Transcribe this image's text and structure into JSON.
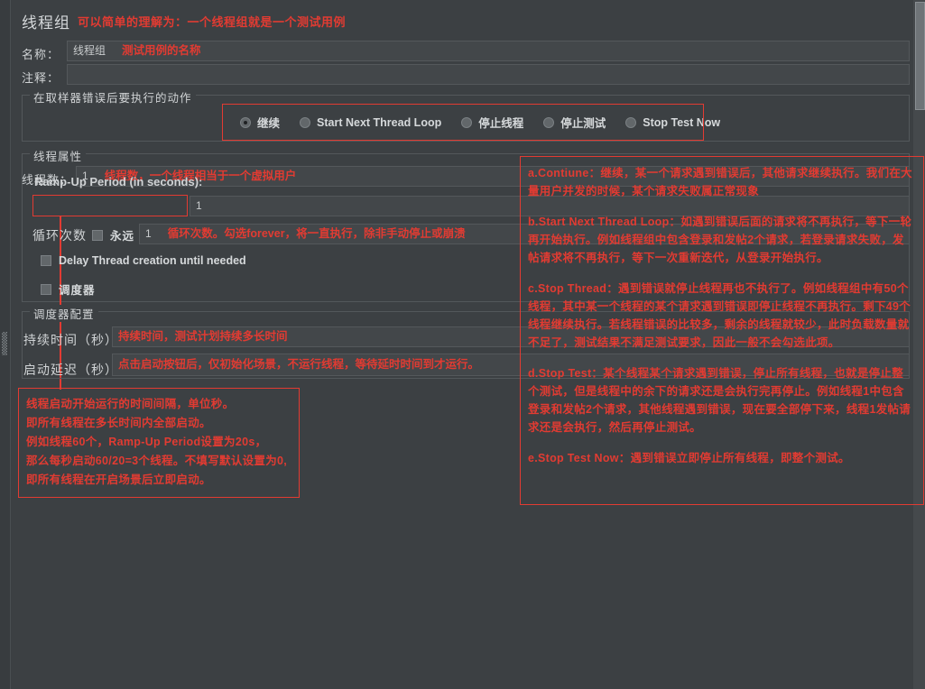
{
  "window": {
    "title": "线程组",
    "title_note": "可以简单的理解为：一个线程组就是一个测试用例"
  },
  "form": {
    "name_label": "名称：",
    "name_value": "线程组",
    "name_note": "测试用例的名称",
    "comment_label": "注释：",
    "comment_value": ""
  },
  "error_action": {
    "group_title": "在取样器错误后要执行的动作",
    "options": [
      {
        "label": "继续",
        "selected": true
      },
      {
        "label": "Start Next Thread Loop",
        "selected": false
      },
      {
        "label": "停止线程",
        "selected": false
      },
      {
        "label": "停止测试",
        "selected": false
      },
      {
        "label": "Stop Test Now",
        "selected": false
      }
    ]
  },
  "thread_props": {
    "group_title": "线程属性",
    "threads_label": "线程数：",
    "threads_value": "1",
    "threads_note": "线程数，一个线程相当于一个虚拟用户",
    "rampup_label": "Ramp-Up Period (in seconds):",
    "rampup_value": "1",
    "loop_label": "循环次数",
    "forever_label": "永远",
    "forever_checked": false,
    "loop_value": "1",
    "loop_note": "循环次数。勾选forever，将一直执行，除非手动停止或崩溃",
    "delay_thread_label": "Delay Thread creation until needed",
    "delay_thread_checked": false,
    "scheduler_checkbox_label": "调度器",
    "scheduler_checked": false
  },
  "scheduler": {
    "group_title": "调度器配置",
    "duration_label": "持续时间（秒）",
    "duration_value": "",
    "duration_note": "持续时间，测试计划持续多长时间",
    "delay_label": "启动延迟（秒）",
    "delay_value": "",
    "delay_note": "点击启动按钮后，仅初始化场景，不运行线程，等待延时时间到才运行。"
  },
  "rampup_note": {
    "lines": [
      "线程启动开始运行的时间间隔，单位秒。",
      "即所有线程在多长时间内全部启动。",
      "例如线程60个，Ramp-Up Period设置为20s，",
      "那么每秒启动60/20=3个线程。不填写默认设置为0,",
      "即所有线程在开启场景后立即启动。"
    ]
  },
  "action_notes": {
    "paragraphs": [
      "a.Contiune：继续，某一个请求遇到错误后，其他请求继续执行。我们在大量用户并发的时候，某个请求失败属正常现象",
      "b.Start Next Thread Loop：如遇到错误后面的请求将不再执行，等下一轮再开始执行。例如线程组中包含登录和发帖2个请求，若登录请求失败，发帖请求将不再执行，等下一次重新迭代，从登录开始执行。",
      "c.Stop Thread：遇到错误就停止线程再也不执行了。例如线程组中有50个线程，其中某一个线程的某个请求遇到错误即停止线程不再执行。剩下49个线程继续执行。若线程错误的比较多，剩余的线程就较少，此时负载数量就不足了，测试结果不满足测试要求，因此一般不会勾选此项。",
      "d.Stop Test：某个线程某个请求遇到错误，停止所有线程，也就是停止整个测试，但是线程中的余下的请求还是会执行完再停止。例如线程1中包含登录和发帖2个请求，其他线程遇到错误，现在要全部停下来，线程1发帖请求还是会执行，然后再停止测试。",
      "e.Stop Test Now：遇到错误立即停止所有线程，即整个测试。"
    ]
  },
  "colors": {
    "annotation_red": "#e23b32",
    "panel_bg": "#3c4043",
    "field_bg": "#43474a"
  }
}
